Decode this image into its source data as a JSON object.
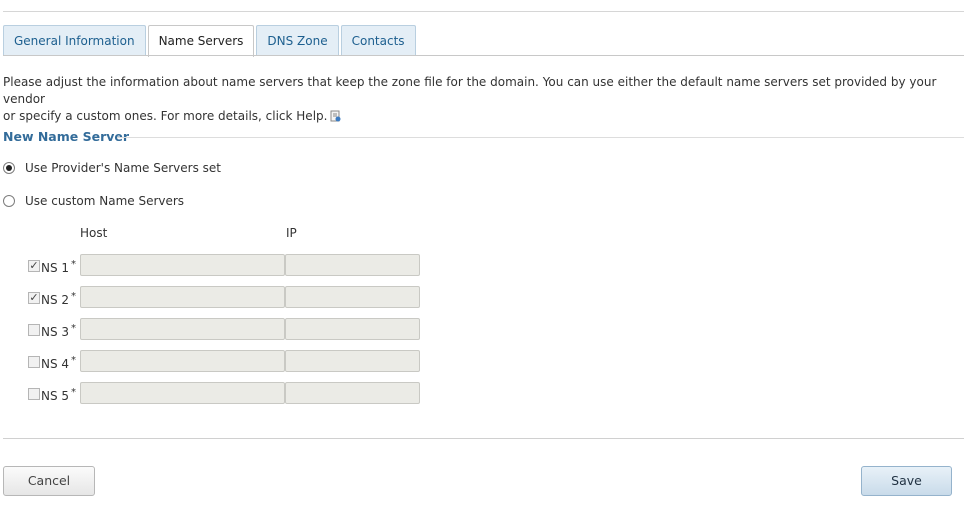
{
  "tabs": [
    {
      "label": "General Information",
      "active": false
    },
    {
      "label": "Name Servers",
      "active": true
    },
    {
      "label": "DNS Zone",
      "active": false
    },
    {
      "label": "Contacts",
      "active": false
    }
  ],
  "description": {
    "line1": "Please adjust the information about name servers that keep the zone file for the domain. You can use either the default name servers set provided by your vendor",
    "line2": "or specify a custom ones. For more details, click Help."
  },
  "section": {
    "title": "New Name Server",
    "option_provider": "Use Provider's Name Servers set",
    "option_custom": "Use custom Name Servers",
    "selected": "provider",
    "host_header": "Host",
    "ip_header": "IP",
    "rows": [
      {
        "label": "NS 1",
        "required": "*",
        "checked": true,
        "host": "",
        "ip": ""
      },
      {
        "label": "NS 2",
        "required": "*",
        "checked": true,
        "host": "",
        "ip": ""
      },
      {
        "label": "NS 3",
        "required": "*",
        "checked": false,
        "host": "",
        "ip": ""
      },
      {
        "label": "NS 4",
        "required": "*",
        "checked": false,
        "host": "",
        "ip": ""
      },
      {
        "label": "NS 5",
        "required": "*",
        "checked": false,
        "host": "",
        "ip": ""
      }
    ]
  },
  "buttons": {
    "cancel": "Cancel",
    "save": "Save"
  },
  "icons": {
    "help": "help-book-icon"
  }
}
